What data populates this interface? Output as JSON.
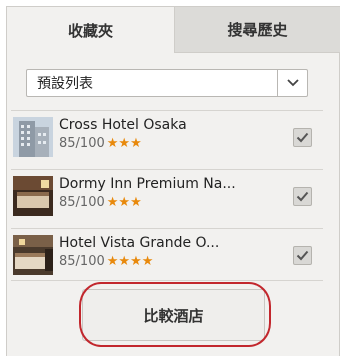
{
  "tabs": [
    {
      "label": "收藏夾",
      "active": true
    },
    {
      "label": "搜尋歷史",
      "active": false
    }
  ],
  "list_select": {
    "selected": "預設列表",
    "icon": "chevron-down-icon"
  },
  "hotels": [
    {
      "name": "Cross Hotel Osaka",
      "score": "85/100",
      "stars": 3,
      "checked": true
    },
    {
      "name": "Dormy Inn Premium Na...",
      "score": "85/100",
      "stars": 3,
      "checked": true
    },
    {
      "name": "Hotel Vista Grande O...",
      "score": "85/100",
      "stars": 4,
      "checked": true
    }
  ],
  "compare_button": {
    "label": "比較酒店"
  },
  "colors": {
    "star": "#e8890c",
    "highlight": "#c2272d",
    "panel": "#f2f1ef",
    "inactive_tab": "#dcdbd8"
  }
}
